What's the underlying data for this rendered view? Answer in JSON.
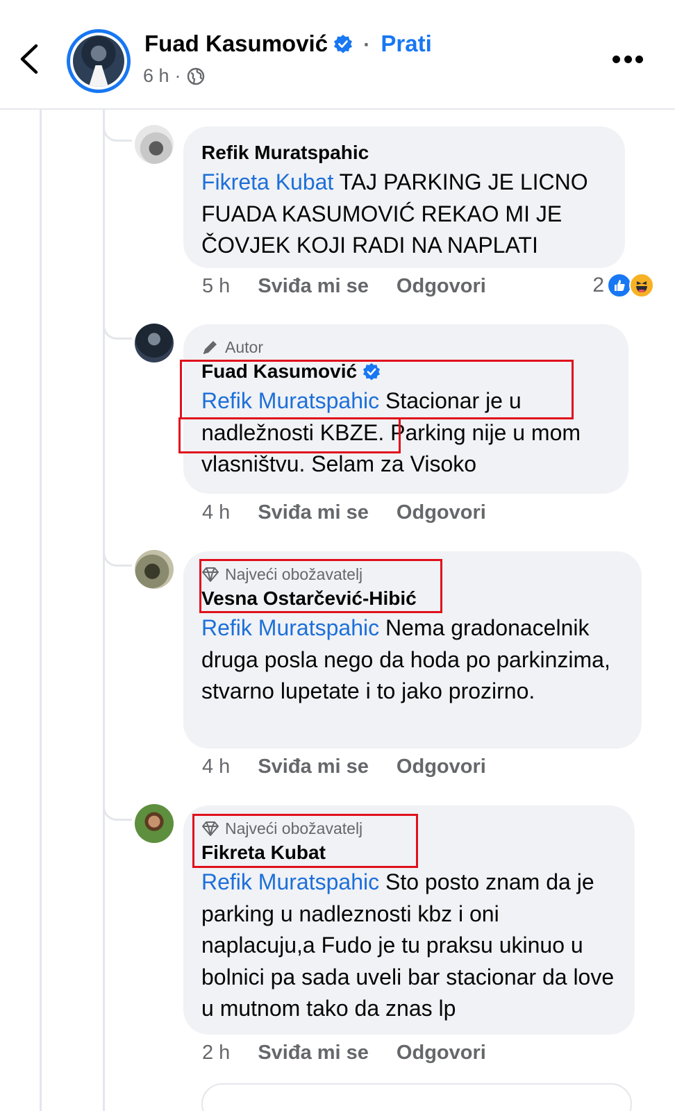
{
  "header": {
    "page_name": "Fuad Kasumović",
    "separator": "·",
    "follow_label": "Prati",
    "time": "6 h",
    "meta_separator": "·",
    "icons": [
      "back-arrow-icon",
      "verified-icon",
      "globe-icon",
      "more-icon"
    ]
  },
  "comments": [
    {
      "badge": "",
      "author": "Refik Muratspahic",
      "mention": "Fikreta Kubat",
      "text": " TAJ PARKING JE LICNO FUADA KASUMOVIĆ REKAO MI JE ČOVJEK KOJI RADI NA NAPLATI",
      "time": "5 h",
      "like_label": "Sviđa mi se",
      "reply_label": "Odgovori",
      "reaction_count": "2"
    },
    {
      "badge": "Autor",
      "author": "Fuad Kasumović",
      "mention": "Refik Muratspahic",
      "text": " Stacionar je u nadležnosti KBZE. Parking nije u mom vlasništvu. Selam za Visoko",
      "time": "4 h",
      "like_label": "Sviđa mi se",
      "reply_label": "Odgovori"
    },
    {
      "badge": "Najveći obožavatelj",
      "author": "Vesna Ostarčević-Hibić",
      "mention": "Refik Muratspahic",
      "text": " Nema gradonacelnik druga posla nego da hoda po parkinzima, stvarno lupetate i to jako prozirno.",
      "time": "4 h",
      "like_label": "Sviđa mi se",
      "reply_label": "Odgovori"
    },
    {
      "badge": "Najveći obožavatelj",
      "author": "Fikreta Kubat",
      "mention": "Refik Muratspahic",
      "text": " Sto posto znam da je parking u nadleznosti kbz i oni naplacuju,a Fudo je tu praksu ukinuo u bolnici pa sada uveli bar stacionar da love u mutnom tako da znas lp",
      "time": "2 h",
      "like_label": "Sviđa mi se",
      "reply_label": "Odgovori"
    }
  ],
  "colors": {
    "accent": "#1877f2",
    "mention": "#1d6fd9",
    "bubble": "#f0f2f5",
    "secondary_text": "#65676b",
    "highlight_box": "#e0101c"
  }
}
